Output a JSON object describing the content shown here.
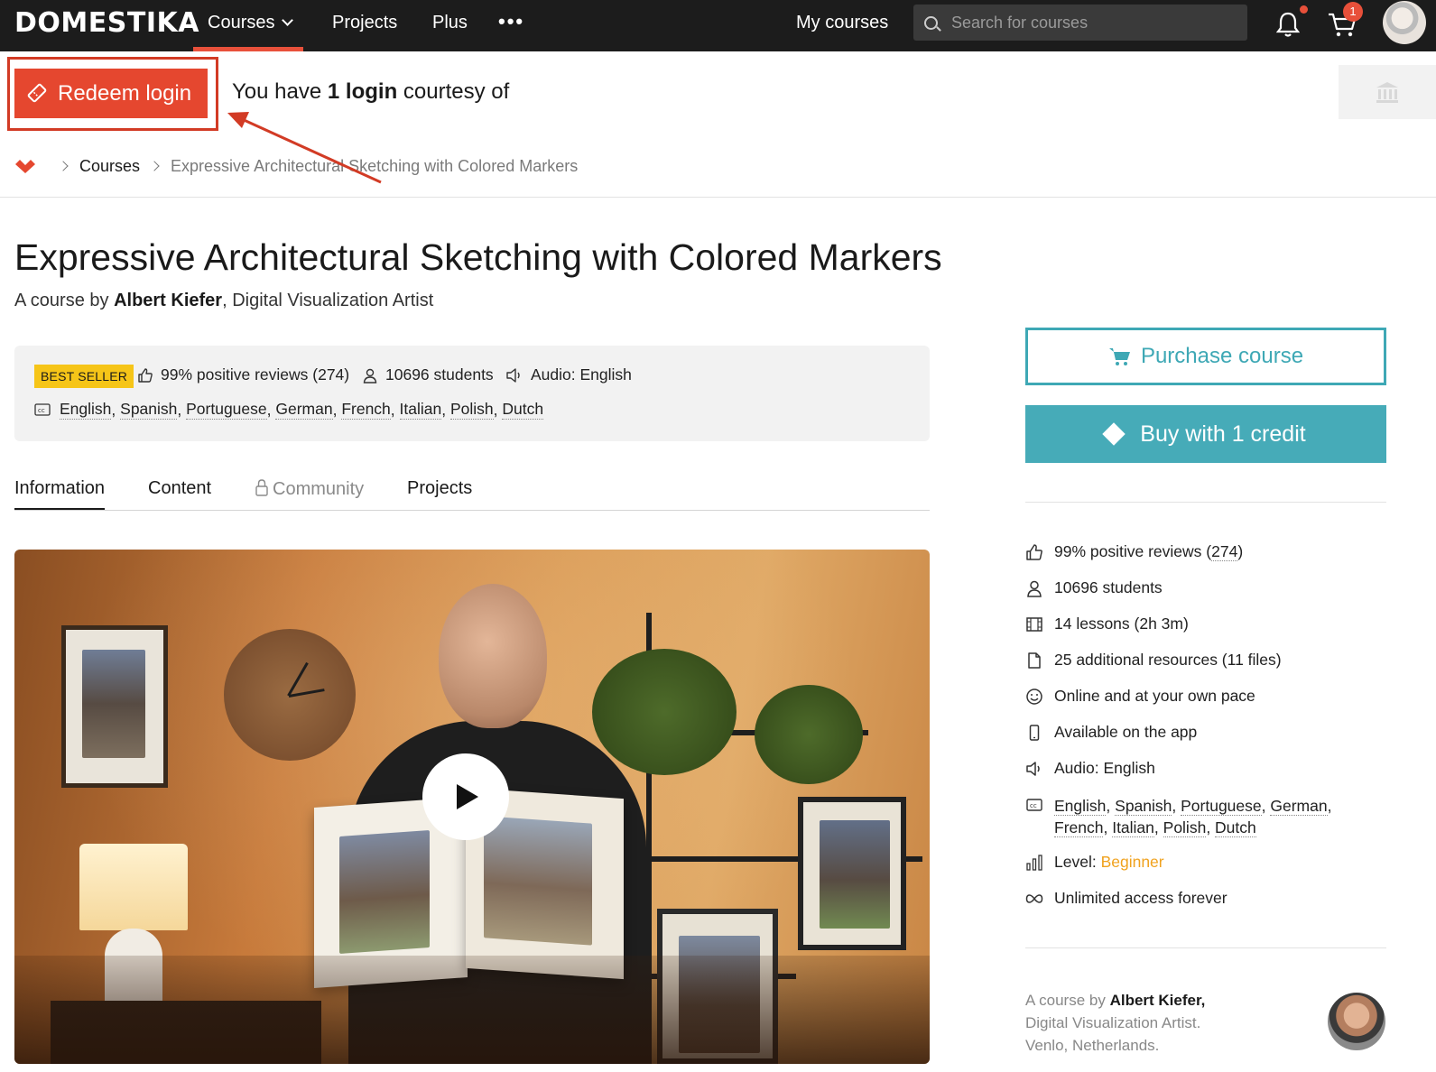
{
  "topnav": {
    "logo": "DOMESTIKA",
    "courses_label": "Courses",
    "projects_label": "Projects",
    "plus_label": "Plus",
    "more_label": "•••",
    "my_courses_label": "My courses",
    "search_placeholder": "Search for courses",
    "cart_count": "1"
  },
  "redeem": {
    "button_label": "Redeem login",
    "courtesy_prefix": "You have ",
    "courtesy_bold": "1 login",
    "courtesy_suffix": " courtesy of"
  },
  "breadcrumb": {
    "courses": "Courses",
    "current": "Expressive Architectural Sketching with Colored Markers"
  },
  "course": {
    "title": "Expressive Architectural Sketching with Colored Markers",
    "by_prefix": "A course by ",
    "author": "Albert Kiefer",
    "author_suffix": ", Digital Visualization Artist"
  },
  "info_box": {
    "badge": "BEST SELLER",
    "reviews": "99% positive reviews (274)",
    "students": "10696 students",
    "audio": "Audio: English",
    "subtitles": [
      "English",
      "Spanish",
      "Portuguese",
      "German",
      "French",
      "Italian",
      "Polish",
      "Dutch"
    ]
  },
  "tabs": [
    "Information",
    "Content",
    "Community",
    "Projects"
  ],
  "sidebar": {
    "purchase_label": "Purchase course",
    "credit_label": "Buy with 1 credit",
    "reviews_prefix": "99% positive reviews (",
    "reviews_count": "274",
    "reviews_suffix": ")",
    "students": "10696 students",
    "lessons": "14 lessons (2h 3m)",
    "resources": "25 additional resources (11 files)",
    "pace": "Online and at your own pace",
    "app": "Available on the app",
    "audio": "Audio: English",
    "subtitles_line1": [
      "English",
      "Spanish",
      "Portuguese",
      "German"
    ],
    "subtitles_line2": [
      "French",
      "Italian",
      "Polish",
      "Dutch"
    ],
    "level_label": "Level: ",
    "level_value": "Beginner",
    "access": "Unlimited access forever"
  },
  "author_card": {
    "prefix": "A course by ",
    "name": "Albert Kiefer,",
    "role": "Digital Visualization Artist.",
    "location": "Venlo, Netherlands."
  },
  "colors": {
    "brand_red": "#e5472f",
    "teal": "#46abb8",
    "badge_yellow": "#f6c518",
    "level_orange": "#f0a21e"
  }
}
